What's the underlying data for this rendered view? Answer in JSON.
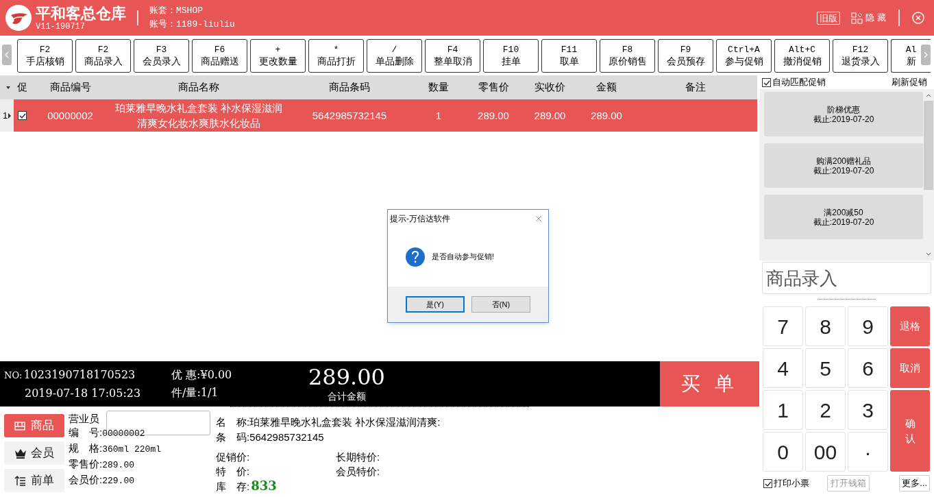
{
  "header": {
    "title": "平和客总仓库",
    "version": "V11-190717",
    "account_set": "账套：MSHOP",
    "account_no": "账号：1189-liuliu",
    "old_version": "旧版",
    "hide": "隐 藏"
  },
  "toolbar": [
    {
      "key": "F2",
      "label": "手店核销"
    },
    {
      "key": "F2",
      "label": "商品录入"
    },
    {
      "key": "F3",
      "label": "会员录入"
    },
    {
      "key": "F6",
      "label": "商品赠送"
    },
    {
      "key": "+",
      "label": "更改数量"
    },
    {
      "key": "*",
      "label": "商品打折"
    },
    {
      "key": "/",
      "label": "单品删除"
    },
    {
      "key": "F4",
      "label": "整单取消"
    },
    {
      "key": "F10",
      "label": "挂单"
    },
    {
      "key": "F11",
      "label": "取单"
    },
    {
      "key": "F8",
      "label": "原价销售"
    },
    {
      "key": "F9",
      "label": "会员预存"
    },
    {
      "key": "Ctrl+A",
      "label": "参与促销"
    },
    {
      "key": "Alt+C",
      "label": "撤消促销"
    },
    {
      "key": "F12",
      "label": "退货录入"
    },
    {
      "key": "Al",
      "label": "新"
    }
  ],
  "table": {
    "promo_column": "促",
    "columns": [
      "商品编号",
      "商品名称",
      "商品条码",
      "数量",
      "零售价",
      "实收价",
      "金额",
      "备注"
    ],
    "rows": [
      {
        "index": "1",
        "selected": true,
        "promo": true,
        "cells": [
          "00000002",
          "珀莱雅早晚水礼盒套装 补水保湿滋润清爽女化妆水爽肤水化妆品",
          "5642985732145",
          "1",
          "289.00",
          "289.00",
          "289.00",
          ""
        ]
      }
    ]
  },
  "dialog": {
    "title": "提示-万信达软件",
    "message": "是否自动参与促销!",
    "buttons": [
      {
        "label": "是(Y)",
        "selected": true
      },
      {
        "label": "否(N)",
        "selected": false
      }
    ]
  },
  "summary": {
    "no_label": "NO:",
    "no": "1023190718170523",
    "datetime": "2019-07-18 17:05:23",
    "discount": "优 惠:¥0.00",
    "count": "件/量:1/1",
    "total": "289.00",
    "total_label": "合计金额",
    "pay": "买 单"
  },
  "side_tabs": [
    {
      "label": "商品",
      "selected": true,
      "kind": "goods"
    },
    {
      "label": "会员",
      "selected": false,
      "kind": "member"
    },
    {
      "label": "前单",
      "selected": false,
      "kind": "previous"
    }
  ],
  "info": {
    "clerk_label": "营业员",
    "fields": [
      {
        "label": "编　号:",
        "value": "00000002"
      },
      {
        "label": "规　格:",
        "value": "360ml 220ml"
      },
      {
        "label": "零售价:",
        "value": "289.00"
      },
      {
        "label": "会员价:",
        "value": "229.00"
      }
    ],
    "name": "名　称:珀莱雅早晚水礼盒套装 补水保湿滋润清爽:",
    "barcode": "条　码:5642985732145",
    "promo_price": "促销价:",
    "special_price": "特　价:",
    "stock_label": "库　存:",
    "stock": "833",
    "long_price": "长期特价:",
    "member_special": "会员特价:"
  },
  "promotions": {
    "auto_match": {
      "label": "自动匹配促销",
      "checked": true
    },
    "refresh": "刷新促销",
    "items": [
      {
        "name": "阶梯优惠",
        "deadline": "截止:2019-07-20"
      },
      {
        "name": "购满200赠礼品",
        "deadline": "截止:2019-07-20"
      },
      {
        "name": "满200减50",
        "deadline": "截止:2019-07-20"
      }
    ]
  },
  "input": {
    "placeholder": "商品录入"
  },
  "keypad": [
    {
      "label": "7",
      "kind": "digit"
    },
    {
      "label": "8",
      "kind": "digit"
    },
    {
      "label": "9",
      "kind": "digit"
    },
    {
      "label": "退格",
      "kind": "action"
    },
    {
      "label": "4",
      "kind": "digit"
    },
    {
      "label": "5",
      "kind": "digit"
    },
    {
      "label": "6",
      "kind": "digit"
    },
    {
      "label": "取消",
      "kind": "action"
    },
    {
      "label": "1",
      "kind": "digit"
    },
    {
      "label": "2",
      "kind": "digit"
    },
    {
      "label": "3",
      "kind": "digit"
    },
    {
      "label": "确认",
      "kind": "confirm"
    },
    {
      "label": "0",
      "kind": "digit"
    },
    {
      "label": "00",
      "kind": "digit"
    },
    {
      "label": "·",
      "kind": "digit"
    }
  ],
  "footer": {
    "print": {
      "label": "打印小票",
      "checked": true
    },
    "cash_drawer": {
      "label": "打开钱箱",
      "disabled": true
    },
    "more": "更多..."
  }
}
